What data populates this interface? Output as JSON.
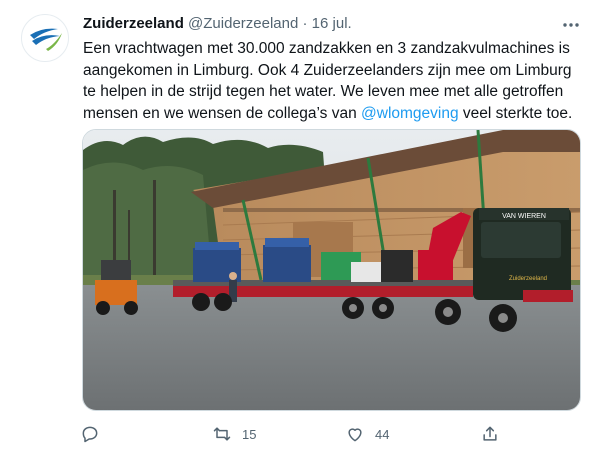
{
  "tweet": {
    "author_name": "Zuiderzeeland",
    "author_handle": "@Zuiderzeeland",
    "separator": "·",
    "date": "16 jul.",
    "text_before_mention": "Een vrachtwagen met 30.000 zandzakken en 3 zandzakvulmachines is aangekomen in Limburg. Ook 4 Zuiderzeelanders zijn mee om Limburg te helpen in de strijd tegen het water. We leven mee met alle getroffen mensen en we wensen de collega’s van ",
    "mention": "@wlomgeving",
    "text_after_mention": " veel sterkte toe.",
    "truck_sign": "VAN WIEREN",
    "truck_brand": "Zuiderzeeland"
  },
  "actions": {
    "reply_count": "",
    "retweet_count": "15",
    "like_count": "44",
    "share_count": ""
  },
  "icons": {
    "avatar": "zuiderzeeland-logo-icon",
    "more": "more-dots-icon",
    "reply": "reply-icon",
    "retweet": "retweet-icon",
    "like": "heart-icon",
    "share": "share-icon"
  },
  "colors": {
    "text": "#0f1419",
    "secondary": "#536471",
    "link": "#1d9bf0",
    "truck_cab": "#1f2a22",
    "crane": "#c8102e"
  }
}
